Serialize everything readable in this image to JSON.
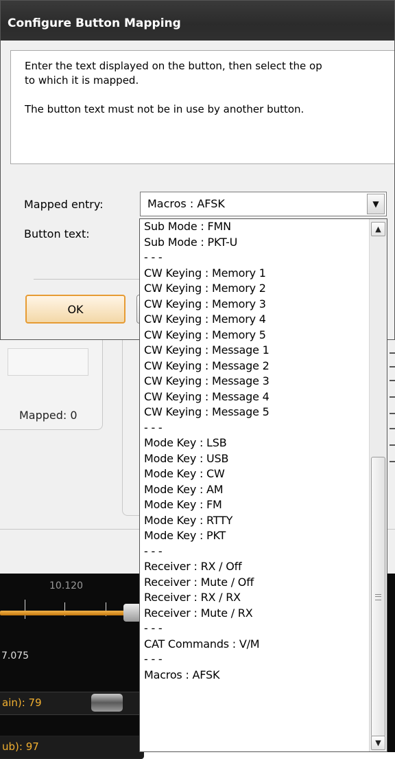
{
  "dialog": {
    "title": "Configure Button Mapping",
    "description_line1": "Enter the text displayed on the button, then select the op",
    "description_line2": "to which it is mapped.",
    "description_line3": "The button text must not be in use by another button.",
    "mapped_entry_label": "Mapped entry:",
    "mapped_entry_value": "Macros : AFSK",
    "button_text_label": "Button text:",
    "ok_label": "OK"
  },
  "dropdown": {
    "selected_index": 38,
    "items": [
      "Sub Mode : FMN",
      "Sub Mode : PKT-U",
      "- - -",
      "CW Keying : Memory 1",
      "CW Keying : Memory 2",
      "CW Keying : Memory 3",
      "CW Keying : Memory 4",
      "CW Keying : Memory 5",
      "CW Keying : Message 1",
      "CW Keying : Message 2",
      "CW Keying : Message 3",
      "CW Keying : Message 4",
      "CW Keying : Message 5",
      "- - -",
      "Mode Key : LSB",
      "Mode Key : USB",
      "Mode Key : CW",
      "Mode Key : AM",
      "Mode Key : FM",
      "Mode Key : RTTY",
      "Mode Key : PKT",
      "- - -",
      "Receiver : RX / Off",
      "Receiver : Mute / Off",
      "Receiver : RX / RX",
      "Receiver : Mute / RX",
      "- - -",
      "CAT Commands : V/M",
      "- - -",
      "Macros : AFSK"
    ]
  },
  "background": {
    "mapped_count_label": "Mapped: 0",
    "freq_top": "10.120",
    "freq_bottom": "7.075",
    "level_main": "ain): 79",
    "level_sub": "ub): 97"
  },
  "colors": {
    "accent_orange": "#e69b33",
    "level_text": "#f2b030",
    "selection": "#b8b8b8"
  }
}
